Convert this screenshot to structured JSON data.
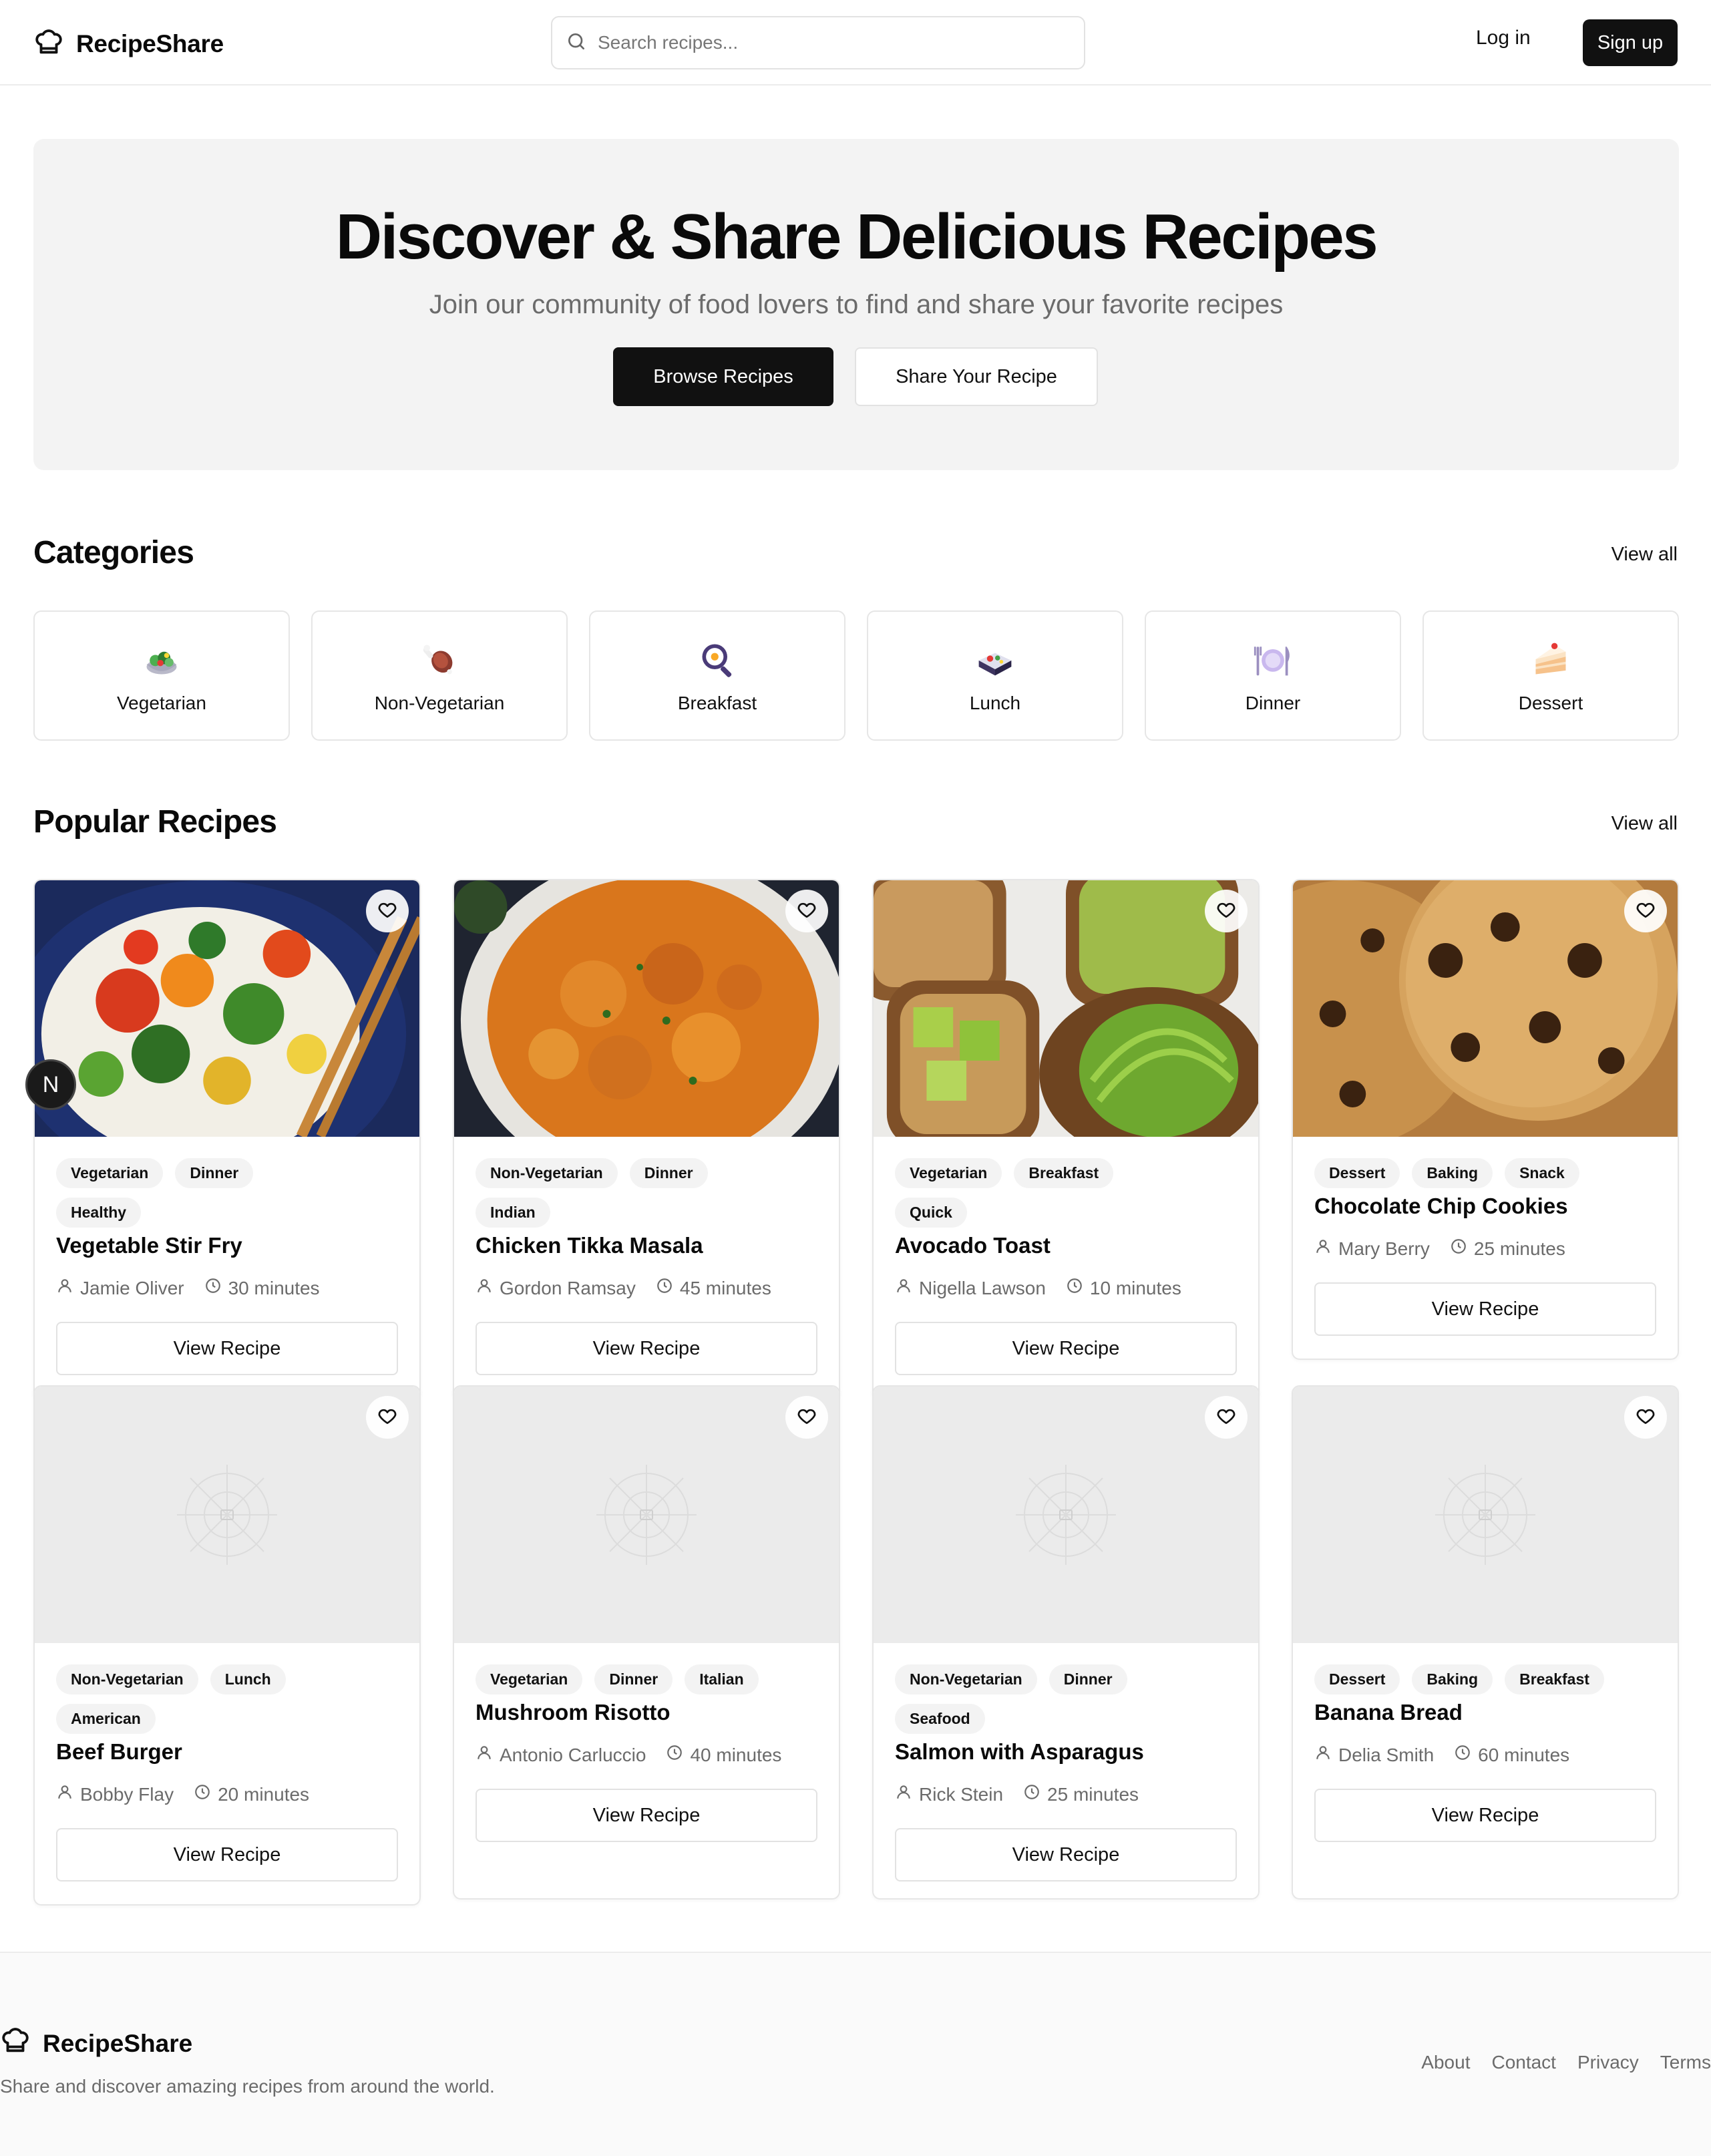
{
  "header": {
    "brand": "RecipeShare",
    "search_placeholder": "Search recipes...",
    "login": "Log in",
    "signup": "Sign up"
  },
  "hero": {
    "title": "Discover & Share Delicious Recipes",
    "subtitle": "Join our community of food lovers to find and share your favorite recipes",
    "browse": "Browse Recipes",
    "share": "Share Your Recipe"
  },
  "categories": {
    "title": "Categories",
    "view_all": "View all",
    "items": [
      {
        "label": "Vegetarian",
        "icon": "salad-icon"
      },
      {
        "label": "Non-Vegetarian",
        "icon": "meat-on-bone-icon"
      },
      {
        "label": "Breakfast",
        "icon": "frying-pan-egg-icon"
      },
      {
        "label": "Lunch",
        "icon": "bento-box-icon"
      },
      {
        "label": "Dinner",
        "icon": "fork-knife-plate-icon"
      },
      {
        "label": "Dessert",
        "icon": "cake-slice-icon"
      }
    ]
  },
  "popular": {
    "title": "Popular Recipes",
    "view_all": "View all",
    "view_recipe": "View Recipe",
    "recipes": [
      {
        "title": "Vegetable Stir Fry",
        "tags": [
          "Vegetarian",
          "Dinner",
          "Healthy"
        ],
        "author": "Jamie Oliver",
        "time": "30 minutes"
      },
      {
        "title": "Chicken Tikka Masala",
        "tags": [
          "Non-Vegetarian",
          "Dinner",
          "Indian"
        ],
        "author": "Gordon Ramsay",
        "time": "45 minutes"
      },
      {
        "title": "Avocado Toast",
        "tags": [
          "Vegetarian",
          "Breakfast",
          "Quick"
        ],
        "author": "Nigella Lawson",
        "time": "10 minutes"
      },
      {
        "title": "Chocolate Chip Cookies",
        "tags": [
          "Dessert",
          "Baking",
          "Snack"
        ],
        "author": "Mary Berry",
        "time": "25 minutes"
      },
      {
        "title": "Beef Burger",
        "tags": [
          "Non-Vegetarian",
          "Lunch",
          "American"
        ],
        "author": "Bobby Flay",
        "time": "20 minutes"
      },
      {
        "title": "Mushroom Risotto",
        "tags": [
          "Vegetarian",
          "Dinner",
          "Italian"
        ],
        "author": "Antonio Carluccio",
        "time": "40 minutes"
      },
      {
        "title": "Salmon with Asparagus",
        "tags": [
          "Non-Vegetarian",
          "Dinner",
          "Seafood"
        ],
        "author": "Rick Stein",
        "time": "25 minutes"
      },
      {
        "title": "Banana Bread",
        "tags": [
          "Dessert",
          "Baking",
          "Breakfast"
        ],
        "author": "Delia Smith",
        "time": "60 minutes"
      }
    ]
  },
  "badge": "N",
  "footer": {
    "brand": "RecipeShare",
    "tagline": "Share and discover amazing recipes from around the world.",
    "links": [
      "About",
      "Contact",
      "Privacy",
      "Terms"
    ]
  }
}
